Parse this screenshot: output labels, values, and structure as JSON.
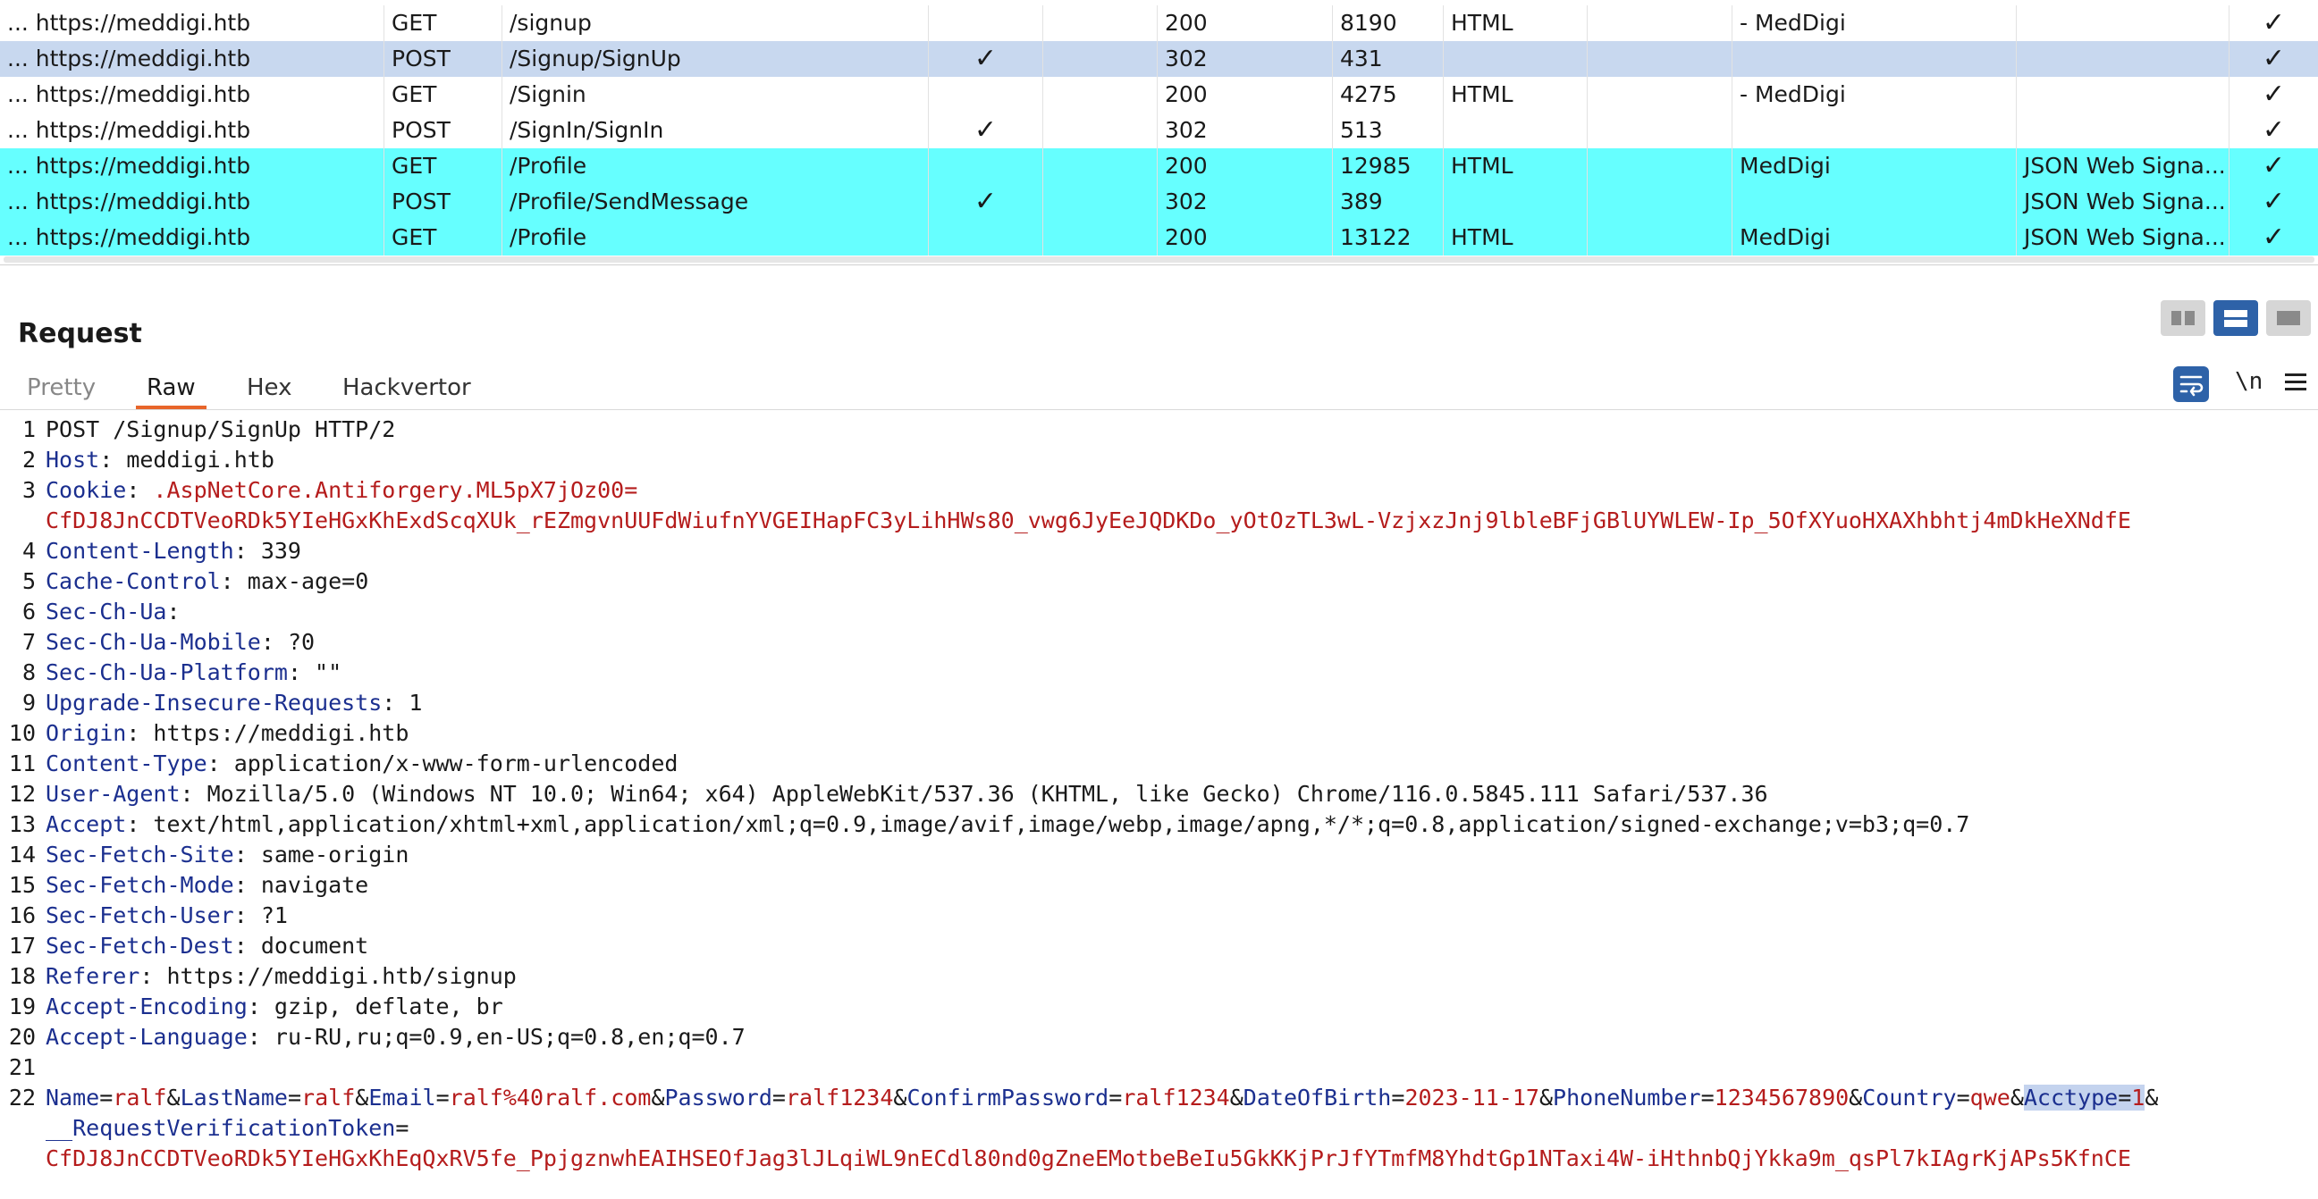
{
  "history": {
    "rows": [
      {
        "host": "... https://meddigi.htb",
        "method": "GET",
        "url": "/signup",
        "params": "",
        "status": "200",
        "length": "8190",
        "mime": "HTML",
        "title": "- MedDigi",
        "comment": "",
        "tls": "✓",
        "style": ""
      },
      {
        "host": "... https://meddigi.htb",
        "method": "POST",
        "url": "/Signup/SignUp",
        "params": "✓",
        "status": "302",
        "length": "431",
        "mime": "",
        "title": "",
        "comment": "",
        "tls": "✓",
        "style": "sel"
      },
      {
        "host": "... https://meddigi.htb",
        "method": "GET",
        "url": "/Signin",
        "params": "",
        "status": "200",
        "length": "4275",
        "mime": "HTML",
        "title": "- MedDigi",
        "comment": "",
        "tls": "✓",
        "style": ""
      },
      {
        "host": "... https://meddigi.htb",
        "method": "POST",
        "url": "/SignIn/SignIn",
        "params": "✓",
        "status": "302",
        "length": "513",
        "mime": "",
        "title": "",
        "comment": "",
        "tls": "✓",
        "style": ""
      },
      {
        "host": "... https://meddigi.htb",
        "method": "GET",
        "url": "/Profile",
        "params": "",
        "status": "200",
        "length": "12985",
        "mime": "HTML",
        "title": "MedDigi",
        "comment": "JSON Web Signa...",
        "tls": "✓",
        "style": "cyan"
      },
      {
        "host": "... https://meddigi.htb",
        "method": "POST",
        "url": "/Profile/SendMessage",
        "params": "✓",
        "status": "302",
        "length": "389",
        "mime": "",
        "title": "",
        "comment": "JSON Web Signa...",
        "tls": "✓",
        "style": "cyan"
      },
      {
        "host": "... https://meddigi.htb",
        "method": "GET",
        "url": "/Profile",
        "params": "",
        "status": "200",
        "length": "13122",
        "mime": "HTML",
        "title": "MedDigi",
        "comment": "JSON Web Signa...",
        "tls": "✓",
        "style": "cyan"
      }
    ]
  },
  "request": {
    "title": "Request",
    "tabs": [
      "Pretty",
      "Raw",
      "Hex",
      "Hackvertor"
    ],
    "active_tab": "Raw",
    "newline_label": "\\n",
    "line_numbers": [
      "1",
      "2",
      "3",
      "",
      "4",
      "5",
      "6",
      "7",
      "8",
      "9",
      "10",
      "11",
      "12",
      "13",
      "14",
      "15",
      "16",
      "17",
      "18",
      "19",
      "20",
      "21",
      "22",
      "",
      ""
    ],
    "request_line": "POST /Signup/SignUp HTTP/2",
    "headers": [
      {
        "name": "Host",
        "value": "meddigi.htb"
      },
      {
        "name": "Cookie",
        "value": ".AspNetCore.Antiforgery.ML5pX7jOz00="
      },
      {
        "name": "Content-Length",
        "value": "339"
      },
      {
        "name": "Cache-Control",
        "value": "max-age=0"
      },
      {
        "name": "Sec-Ch-Ua",
        "value": ""
      },
      {
        "name": "Sec-Ch-Ua-Mobile",
        "value": "?0"
      },
      {
        "name": "Sec-Ch-Ua-Platform",
        "value": "\"\""
      },
      {
        "name": "Upgrade-Insecure-Requests",
        "value": "1"
      },
      {
        "name": "Origin",
        "value": "https://meddigi.htb"
      },
      {
        "name": "Content-Type",
        "value": "application/x-www-form-urlencoded"
      },
      {
        "name": "User-Agent",
        "value": "Mozilla/5.0 (Windows NT 10.0; Win64; x64) AppleWebKit/537.36 (KHTML, like Gecko) Chrome/116.0.5845.111 Safari/537.36"
      },
      {
        "name": "Accept",
        "value": "text/html,application/xhtml+xml,application/xml;q=0.9,image/avif,image/webp,image/apng,*/*;q=0.8,application/signed-exchange;v=b3;q=0.7"
      },
      {
        "name": "Sec-Fetch-Site",
        "value": "same-origin"
      },
      {
        "name": "Sec-Fetch-Mode",
        "value": "navigate"
      },
      {
        "name": "Sec-Fetch-User",
        "value": "?1"
      },
      {
        "name": "Sec-Fetch-Dest",
        "value": "document"
      },
      {
        "name": "Referer",
        "value": "https://meddigi.htb/signup"
      },
      {
        "name": "Accept-Encoding",
        "value": "gzip, deflate, br"
      },
      {
        "name": "Accept-Language",
        "value": "ru-RU,ru;q=0.9,en-US;q=0.8,en;q=0.7"
      }
    ],
    "cookie_continuation": "CfDJ8JnCCDTVeoRDk5YIeHGxKhExdScqXUk_rEZmgvnUUFdWiufnYVGEIHapFC3yLihHWs80_vwg6JyEeJQDKDo_yOtOzTL3wL-VzjxzJnj9lbleBFjGBlUYWLEW-Ip_5OfXYuoHXAXhbhtj4mDkHeXNdfE",
    "body_params": [
      {
        "k": "Name",
        "v": "ralf"
      },
      {
        "k": "LastName",
        "v": "ralf"
      },
      {
        "k": "Email",
        "v": "ralf%40ralf.com"
      },
      {
        "k": "Password",
        "v": "ralf1234"
      },
      {
        "k": "ConfirmPassword",
        "v": "ralf1234"
      },
      {
        "k": "DateOfBirth",
        "v": "2023-11-17"
      },
      {
        "k": "PhoneNumber",
        "v": "1234567890"
      },
      {
        "k": "Country",
        "v": "qwe"
      },
      {
        "k": "Acctype",
        "v": "1"
      }
    ],
    "token_key": "__RequestVerificationToken",
    "token_value": "CfDJ8JnCCDTVeoRDk5YIeHGxKhEqQxRV5fe_PpjgznwhEAIHSEOfJag3lJLqiWL9nECdl80nd0gZneEMotbeBeIu5GkKKjPrJfYTmfM8YhdtGp1NTaxi4W-iHthnbQjYkka9m_qsPl7kIAgrKjAPs5KfnCE"
  },
  "colors": {
    "selected_row": "#c8d8ef",
    "highlight_row": "#66ffff",
    "tab_underline": "#e8652a",
    "header_name": "#1b2f8f",
    "value_red": "#b51c1c",
    "button_blue": "#2e62a8"
  },
  "icons": {
    "layout_switch": [
      "side-by-side-icon",
      "stacked-icon",
      "single-icon"
    ],
    "wrap": "wrap-lines-icon",
    "menu": "hamburger-icon"
  }
}
